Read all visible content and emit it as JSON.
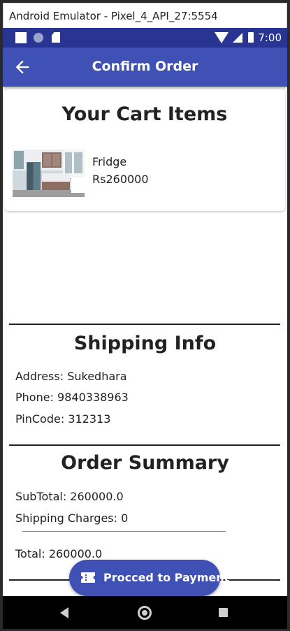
{
  "window": {
    "title": "Android Emulator - Pixel_4_API_27:5554"
  },
  "status_bar": {
    "time": "7:00",
    "icons": [
      "notification-square-icon",
      "circle-icon",
      "sd-card-icon",
      "wifi-icon",
      "signal-icon",
      "battery-icon"
    ]
  },
  "app_bar": {
    "title": "Confirm Order",
    "back_icon": "arrow-back-icon"
  },
  "cart": {
    "title": "Your Cart Items",
    "items": [
      {
        "name": "Fridge",
        "price": "Rs260000",
        "image": "kitchen-fridge-photo"
      }
    ]
  },
  "shipping": {
    "title": "Shipping Info",
    "address": "Address: Sukedhara",
    "phone": "Phone: 9840338963",
    "pincode": "PinCode: 312313"
  },
  "summary": {
    "title": "Order Summary",
    "subtotal": "SubTotal: 260000.0",
    "shipping_charges": "Shipping Charges: 0",
    "total": "Total: 260000.0"
  },
  "payment_button": {
    "label": "Procced to Payment",
    "icon": "payment-ticket-icon"
  },
  "colors": {
    "status_bar": "#283593",
    "primary": "#3f51b5",
    "text": "#222222"
  }
}
